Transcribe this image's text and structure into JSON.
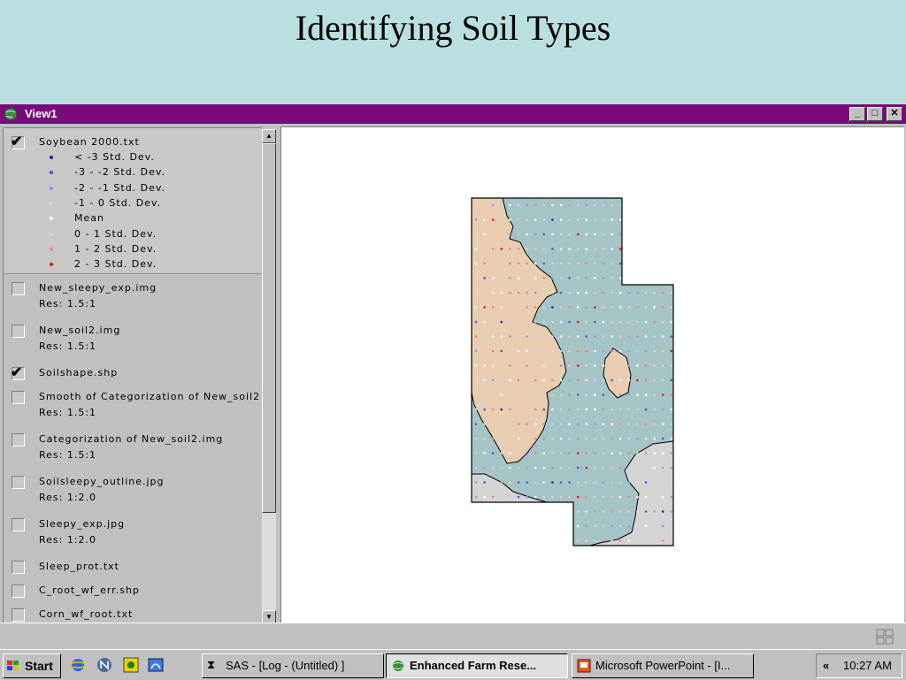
{
  "slide": {
    "title": "Identifying Soil Types"
  },
  "window": {
    "title": "View1",
    "controls": {
      "minimize": "_",
      "maximize": "□",
      "close": "✕"
    }
  },
  "legend": {
    "active_layer": {
      "name": "Soybean 2000.txt",
      "checked": true,
      "classes": [
        {
          "label": "< -3 Std. Dev.",
          "color": "#1020c8"
        },
        {
          "label": "-3 - -2 Std. Dev.",
          "color": "#3a58e6"
        },
        {
          "label": "-2 - -1 Std. Dev.",
          "color": "#7f9af2"
        },
        {
          "label": "-1 - 0 Std. Dev.",
          "color": "#c8d2fa"
        },
        {
          "label": "Mean",
          "color": "#ffffff"
        },
        {
          "label": "0 - 1 Std. Dev.",
          "color": "#f8c8c8"
        },
        {
          "label": "1 - 2 Std. Dev.",
          "color": "#f08080"
        },
        {
          "label": "2 - 3 Std. Dev.",
          "color": "#e01818"
        }
      ]
    },
    "layers": [
      {
        "name": "New_sleepy_exp.img",
        "res": "Res: 1.5:1",
        "checked": false
      },
      {
        "name": "New_soil2.img",
        "res": "Res: 1.5:1",
        "checked": false
      },
      {
        "name": "Soilshape.shp",
        "res": "",
        "checked": true
      },
      {
        "name": "Smooth of Categorization of New_soil2",
        "res": "Res: 1.5:1",
        "checked": false
      },
      {
        "name": "Categorization of New_soil2.img",
        "res": "Res: 1.5:1",
        "checked": false
      },
      {
        "name": "Soilsleepy_outline.jpg",
        "res": "Res: 1:2.0",
        "checked": false
      },
      {
        "name": "Sleepy_exp.jpg",
        "res": "Res: 1:2.0",
        "checked": false
      },
      {
        "name": "Sleep_prot.txt",
        "res": "",
        "checked": false
      },
      {
        "name": "C_root_wf_err.shp",
        "res": "",
        "checked": false
      },
      {
        "name": "Corn_wf_root.txt",
        "res": "",
        "checked": false
      }
    ]
  },
  "map": {
    "colors": {
      "water_soil": "#a4c4c6",
      "sandy_soil": "#e8cdb0",
      "outside_soil": "#d4d4d4",
      "outline": "#000000"
    }
  },
  "taskbar": {
    "start_label": "Start",
    "quick_launch": [
      "ie-icon",
      "netscape-icon",
      "app-icon",
      "browser-icon"
    ],
    "tasks": [
      {
        "label": "SAS - [Log - (Untitled) ]",
        "pressed": false,
        "icon": "hourglass-icon"
      },
      {
        "label": "Enhanced Farm Rese...",
        "pressed": true,
        "icon": "globe-icon"
      },
      {
        "label": "Microsoft PowerPoint - [I...",
        "pressed": false,
        "icon": "powerpoint-icon"
      }
    ],
    "tray": {
      "arrow": "«",
      "clock": "10:27 AM"
    }
  }
}
